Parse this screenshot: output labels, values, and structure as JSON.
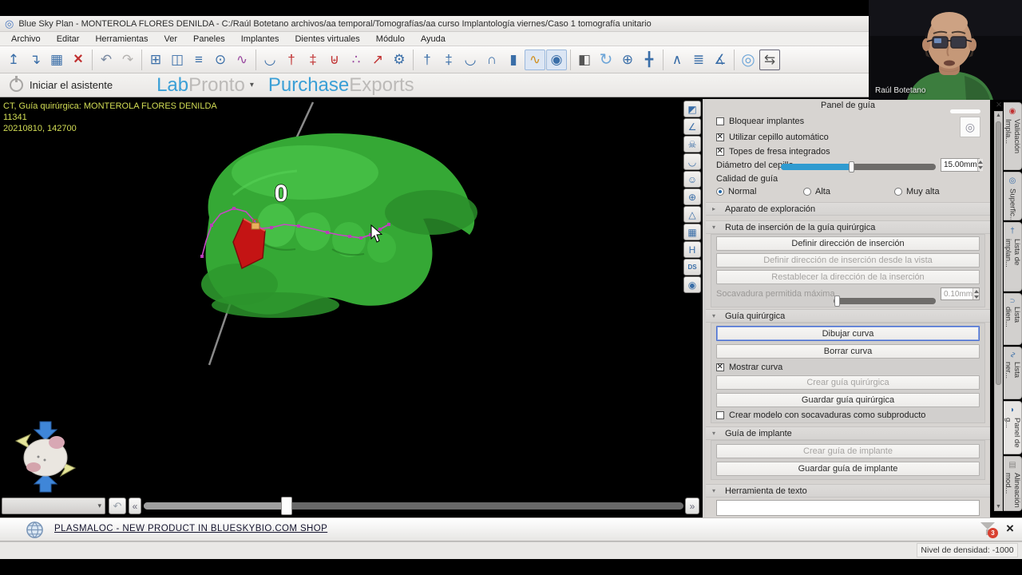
{
  "window": {
    "logo_glyph": "◎",
    "title": "Blue Sky Plan - MONTEROLA FLORES DENILDA - C:/Raúl Botetano archivos/aa temporal/Tomografías/aa curso Implantología viernes/Caso 1 tomografía unitario"
  },
  "menu": {
    "items": [
      "Archivo",
      "Editar",
      "Herramientas",
      "Ver",
      "Paneles",
      "Implantes",
      "Dientes virtuales",
      "Módulo",
      "Ayuda"
    ]
  },
  "toolbar": {
    "icons": [
      {
        "name": "import-icon",
        "glyph": "↥"
      },
      {
        "name": "open-icon",
        "glyph": "↴"
      },
      {
        "name": "save-icon",
        "glyph": "▦"
      },
      {
        "name": "delete-icon",
        "glyph": "×"
      },
      {
        "name": "undo-icon",
        "glyph": "↶"
      },
      {
        "name": "redo-icon",
        "glyph": "↷"
      },
      {
        "name": "layout-grid-icon",
        "glyph": "⊞"
      },
      {
        "name": "panels-icon",
        "glyph": "◫"
      },
      {
        "name": "adjust-sliders-icon",
        "glyph": "≡"
      },
      {
        "name": "zoom-detail-icon",
        "glyph": "⊙"
      },
      {
        "name": "measure-compass-icon",
        "glyph": "∿"
      },
      {
        "name": "dental-arch-icon",
        "glyph": "◡"
      },
      {
        "name": "add-implant-icon",
        "glyph": "†"
      },
      {
        "name": "add-drill-icon",
        "glyph": "‡"
      },
      {
        "name": "add-tooth-icon",
        "glyph": "⊎"
      },
      {
        "name": "implant-path-icon",
        "glyph": "∴"
      },
      {
        "name": "add-screwdriver-icon",
        "glyph": "↗"
      },
      {
        "name": "implant-settings-icon",
        "glyph": "⚙"
      },
      {
        "name": "implant-view-icon",
        "glyph": "†"
      },
      {
        "name": "abutment-view-icon",
        "glyph": "‡"
      },
      {
        "name": "denture-view-icon",
        "glyph": "◡"
      },
      {
        "name": "tooth-view-icon",
        "glyph": "∩"
      },
      {
        "name": "cylinder-view-icon",
        "glyph": "▮"
      },
      {
        "name": "curve-view-icon",
        "glyph": "∿"
      },
      {
        "name": "lock-visibility-icon",
        "glyph": "◉"
      },
      {
        "name": "gradient-window-icon",
        "glyph": "◧"
      },
      {
        "name": "refresh-icon",
        "glyph": "↻"
      },
      {
        "name": "zoom-tool-icon",
        "glyph": "⊕"
      },
      {
        "name": "pan-tool-icon",
        "glyph": "╋"
      },
      {
        "name": "density-level-icon",
        "glyph": "∧"
      },
      {
        "name": "ruler-icon",
        "glyph": "≣"
      },
      {
        "name": "protractor-icon",
        "glyph": "∡"
      },
      {
        "name": "spiral-logo-icon",
        "glyph": "◎"
      },
      {
        "name": "switch-layout-icon",
        "glyph": "⇆"
      }
    ]
  },
  "wizard": {
    "start_label": "Iniciar el asistente",
    "logo_lab": "Lab",
    "logo_pronto": "Pronto",
    "caret": "▾",
    "logo_purchase": "Purchase",
    "logo_exports": "Exports"
  },
  "viewport": {
    "overlay_line1": "CT, Guía quirúrgica: MONTEROLA FLORES DENILDA",
    "overlay_line2": "11341",
    "overlay_line3": "20210810, 142700",
    "marker_label": "0",
    "controls": {
      "undo": "↶",
      "left": "«",
      "right": "»",
      "combo_caret": "▾"
    }
  },
  "viewport_toolbar": {
    "icons": [
      {
        "name": "view-orientation-icon",
        "glyph": "◩"
      },
      {
        "name": "angle-tool-icon",
        "glyph": "∠"
      },
      {
        "name": "skull-view-icon",
        "glyph": "☠"
      },
      {
        "name": "arch-view-icon",
        "glyph": "◡"
      },
      {
        "name": "face-view-icon",
        "glyph": "☺"
      },
      {
        "name": "axes-view-icon",
        "glyph": "⊕"
      },
      {
        "name": "pyramid-view-icon",
        "glyph": "△"
      },
      {
        "name": "grid-view-icon",
        "glyph": "▦"
      },
      {
        "name": "slice-handle-icon",
        "glyph": "H"
      },
      {
        "name": "ds-view-icon",
        "glyph": "DS"
      },
      {
        "name": "snapshot-icon",
        "glyph": "◉"
      }
    ]
  },
  "panel": {
    "title": "Panel de guía",
    "close": "×",
    "spiral_glyph": "◎",
    "scroll_up": "▲",
    "scroll_down": "▼",
    "chevron_right": "▸",
    "chevron_down": "▾",
    "checkbox_bloquear": {
      "label": "Bloquear implantes",
      "checked": false
    },
    "checkbox_cepillo": {
      "label": "Utilizar cepillo automático",
      "checked": true
    },
    "checkbox_topes": {
      "label": "Topes de fresa integrados",
      "checked": true
    },
    "diametro": {
      "label": "Diámetro del cepillo",
      "value": "15.00mm"
    },
    "calidad": {
      "label": "Calidad de guía",
      "options": [
        "Normal",
        "Alta",
        "Muy alta"
      ],
      "selected": "Normal"
    },
    "section_aparato": "Aparato de exploración",
    "section_ruta": "Ruta de inserción de la guía quirúrgica",
    "btn_definir": "Definir dirección de inserción",
    "btn_definir_vista": "Definir dirección de inserción desde la vista",
    "btn_restablecer": "Restablecer la dirección de la inserción",
    "socavadura": {
      "label": "Socavadura permitida máxima",
      "value": "0.10mm"
    },
    "section_guia": "Guía quirúrgica",
    "btn_dibujar": "Dibujar curva",
    "btn_borrar": "Borrar curva",
    "checkbox_mostrar": {
      "label": "Mostrar curva",
      "checked": true
    },
    "btn_crear_guia": "Crear guía quirúrgica",
    "btn_guardar_guia": "Guardar guía quirúrgica",
    "checkbox_subproducto": {
      "label": "Crear modelo con socavaduras como subproducto",
      "checked": false
    },
    "section_implante": "Guía de implante",
    "btn_crear_implante": "Crear guía de implante",
    "btn_guardar_implante": "Guardar guía de implante",
    "section_texto": "Herramienta de texto"
  },
  "tabs": {
    "items": [
      {
        "label": "Validación Impla...",
        "glyph": "◉"
      },
      {
        "label": "Superfic...",
        "glyph": "◎"
      },
      {
        "label": "Lista de implan...",
        "glyph": "†"
      },
      {
        "label": "Lista dien...",
        "glyph": "∩"
      },
      {
        "label": "Lista ner...",
        "glyph": "∿"
      },
      {
        "label": "Panel de g...",
        "glyph": "◗"
      },
      {
        "label": "Alineación mod...",
        "glyph": "▤"
      }
    ]
  },
  "notification": {
    "link": "PLASMALOC - NEW PRODUCT IN BLUESKYBIO.COM SHOP",
    "badge": "3",
    "close": "×"
  },
  "statusbar": {
    "density": "Nivel de densidad: -1000"
  },
  "webcam": {
    "name": "Raúl Botetano"
  }
}
